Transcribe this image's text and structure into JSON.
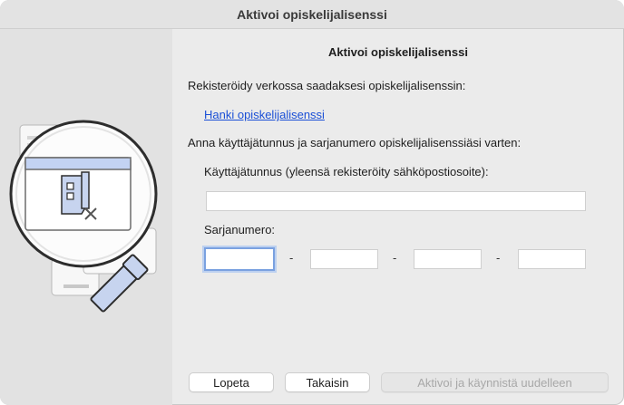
{
  "window": {
    "title": "Aktivoi opiskelijalisenssi"
  },
  "main": {
    "heading": "Aktivoi opiskelijalisenssi",
    "register_text": "Rekisteröidy verkossa saadaksesi opiskelijalisenssin:",
    "link_text": "Hanki opiskelijalisenssi",
    "instructions": "Anna käyttäjätunnus ja sarjanumero opiskelijalisenssiäsi varten:",
    "username_label": "Käyttäjätunnus (yleensä rekisteröity sähköpostiosoite):",
    "username_value": "",
    "serial_label": "Sarjanumero:",
    "serial_parts": [
      "",
      "",
      "",
      ""
    ],
    "serial_separator": "-"
  },
  "buttons": {
    "quit": "Lopeta",
    "back": "Takaisin",
    "activate": "Aktivoi ja käynnistä uudelleen"
  },
  "colors": {
    "link": "#1a4fd6",
    "accent": "#7aa1e0",
    "window_bg": "#ebebeb"
  },
  "icons": {
    "illustration": "magnifying-glass-document-illustration"
  }
}
